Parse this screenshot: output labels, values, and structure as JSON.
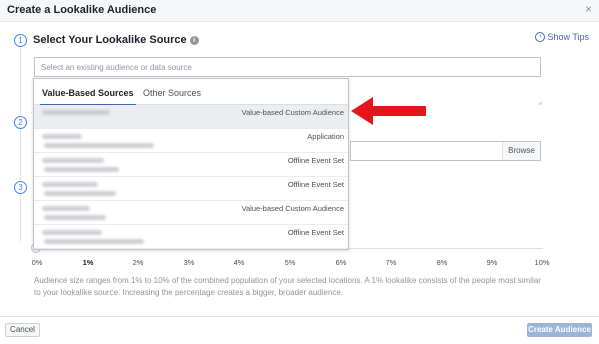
{
  "dialog": {
    "title": "Create a Lookalike Audience",
    "close_glyph": "×"
  },
  "steps": [
    "1",
    "2",
    "3"
  ],
  "source_section": {
    "title": "Select Your Lookalike Source",
    "info_glyph": "i",
    "show_tips_label": "Show Tips",
    "tips_glyph": "‹",
    "search_placeholder": "Select an existing audience or data source"
  },
  "dropdown": {
    "tabs": [
      "Value-Based Sources",
      "Other Sources"
    ],
    "active_tab": "Value-Based Sources",
    "rows": [
      {
        "type": "Value-based Custom Audience",
        "selected": true
      },
      {
        "type": "Application",
        "selected": false
      },
      {
        "type": "Offline Event Set",
        "selected": false
      },
      {
        "type": "Offline Event Set",
        "selected": false
      },
      {
        "type": "Value-based Custom Audience",
        "selected": false
      },
      {
        "type": "Offline Event Set",
        "selected": false
      }
    ]
  },
  "location": {
    "browse_label": "Browse"
  },
  "size_slider": {
    "labels": [
      "0%",
      "1%",
      "2%",
      "3%",
      "4%",
      "5%",
      "6%",
      "7%",
      "8%",
      "9%",
      "10%"
    ],
    "selected_label": "1%",
    "value_percent": 0
  },
  "help_text": "Audience size ranges from 1% to 10% of the combined population of your selected locations. A 1% lookalike consists of the people most similar to your lookalike source. Increasing the percentage creates a bigger, broader audience.",
  "footer": {
    "cancel_label": "Cancel",
    "create_label": "Create Audience"
  },
  "colors": {
    "accent": "#4267b2",
    "step_blue": "#4080ff",
    "annotation_arrow": "#e8141b",
    "create_disabled": "#9cb4d8"
  }
}
